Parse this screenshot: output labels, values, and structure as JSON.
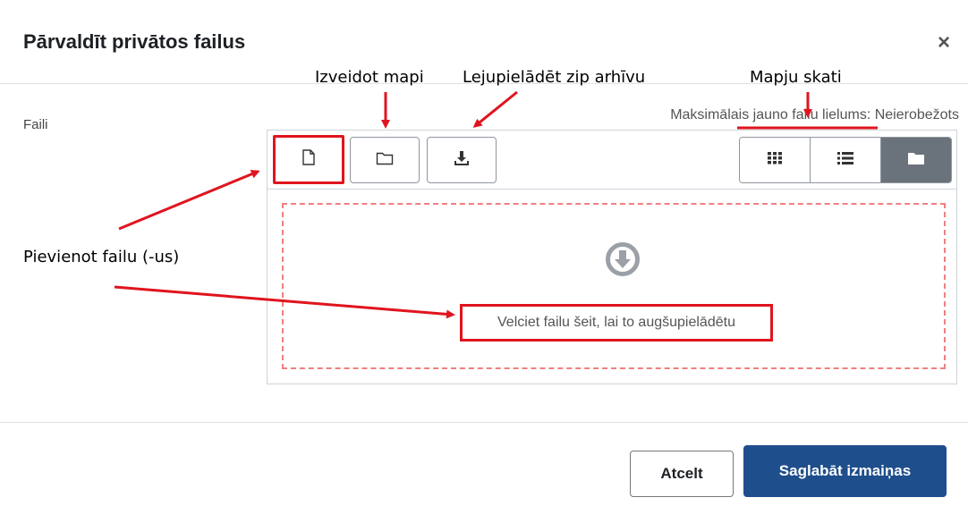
{
  "dialog": {
    "title": "Pārvaldīt privātos failus",
    "close_symbol": "×"
  },
  "filepicker": {
    "label": "Faili",
    "max_size_text": "Maksimālais jauno failu lielums: Neierobežots",
    "toolbar_icons": [
      "add-file-icon",
      "create-folder-icon",
      "download-icon"
    ],
    "view_icons": [
      "grid-icon",
      "list-icon",
      "folder-icon"
    ],
    "active_view": "folder-icon",
    "drop_text": "Velciet failu šeit, lai to augšupielādētu"
  },
  "footer": {
    "cancel_label": "Atcelt",
    "save_label": "Saglabāt izmaiņas"
  },
  "annotations": {
    "create_folder": "Izveidot mapi",
    "download_zip": "Lejupielādēt zip arhīvu",
    "folder_views": "Mapju skati",
    "add_file": "Pievienot failu (-us)"
  },
  "colors": {
    "highlight_red": "#e0141e",
    "primary_button": "#1f4e8c",
    "active_view": "#6a737b"
  }
}
